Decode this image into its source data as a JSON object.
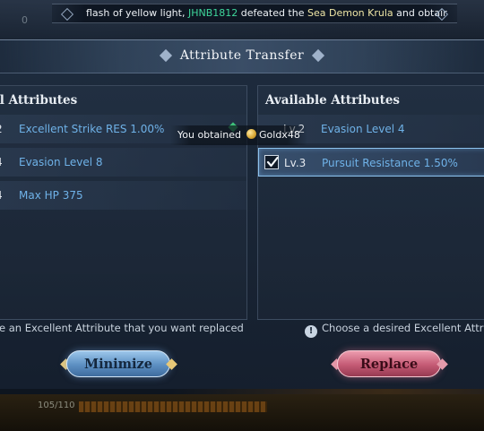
{
  "broadcast": {
    "part1": "flash of yellow light, ",
    "player": "JHNB1812",
    "part2": " defeated the ",
    "monster": "Sea Demon Krula",
    "part3": " and obtair"
  },
  "background": {
    "counter": "0",
    "exp_label": "105/110"
  },
  "dialog": {
    "title": "Attribute Transfer"
  },
  "original": {
    "header": "al Attributes",
    "items": [
      {
        "level": "2",
        "attribute": "Excellent Strike RES 1.00%"
      },
      {
        "level": "4",
        "attribute": "Evasion Level 8"
      },
      {
        "level": "4",
        "attribute": "Max HP 375"
      }
    ],
    "hint": "ose an Excellent Attribute that you want replaced"
  },
  "available": {
    "header": "Available Attributes",
    "items": [
      {
        "level": "Lv.2",
        "attribute": "Evasion Level 4",
        "selected": false
      },
      {
        "level": "Lv.3",
        "attribute": "Pursuit Resistance 1.50%",
        "selected": true
      }
    ],
    "hint": "Choose a desired Excellent Attribu"
  },
  "buttons": {
    "minimize": "Minimize",
    "replace": "Replace"
  },
  "notification": {
    "prefix": "You obtained",
    "item": "Goldx48"
  },
  "icons": {
    "check": "checkmark-icon",
    "info": "info-icon",
    "coin": "gold-coin-icon",
    "gem": "green-gem-icon"
  },
  "colors": {
    "attribute_text": "#6fb2e8",
    "player_name": "#3ed69b",
    "monster_name": "#efe6a6",
    "minimize_button": "#5c8fc2",
    "replace_button": "#c45a74"
  }
}
